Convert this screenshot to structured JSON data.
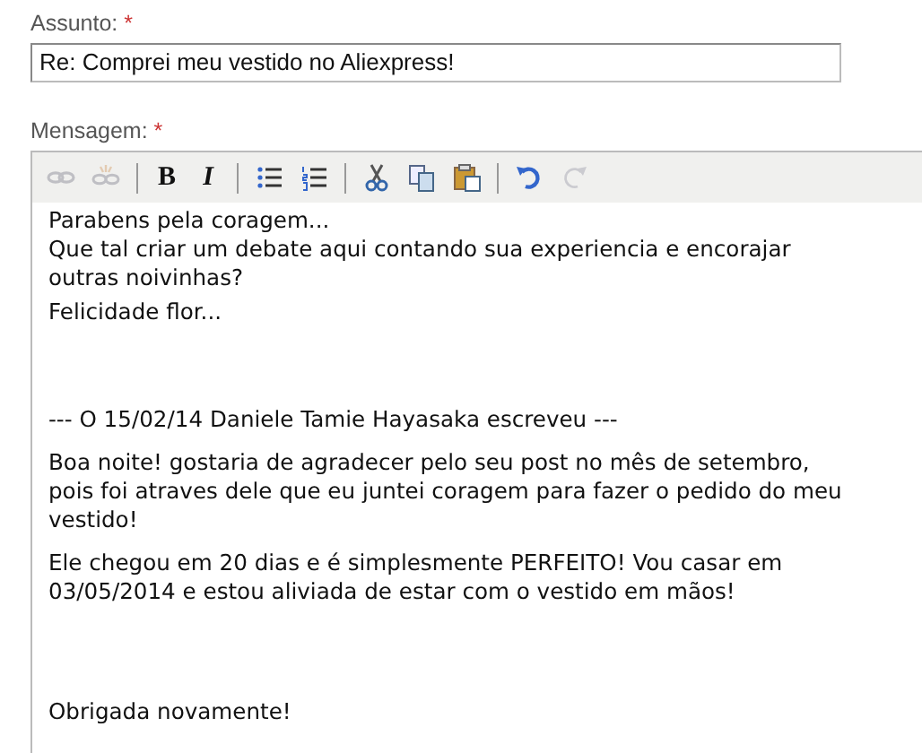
{
  "subject": {
    "label": "Assunto:",
    "required_mark": "*",
    "value": "Re: Comprei meu vestido no Aliexpress!"
  },
  "message": {
    "label": "Mensagem:",
    "required_mark": "*",
    "toolbar": [
      [
        {
          "kind": "link",
          "disabled": true
        },
        {
          "kind": "unlink",
          "disabled": true
        }
      ],
      [
        {
          "kind": "bold",
          "label": "B",
          "disabled": false
        },
        {
          "kind": "italic",
          "label": "I",
          "disabled": false
        }
      ],
      [
        {
          "kind": "bullets",
          "disabled": false
        },
        {
          "kind": "numbers",
          "disabled": false
        }
      ],
      [
        {
          "kind": "cut",
          "disabled": false
        },
        {
          "kind": "copy",
          "disabled": false
        },
        {
          "kind": "paste",
          "disabled": false
        }
      ],
      [
        {
          "kind": "undo",
          "disabled": false
        },
        {
          "kind": "redo",
          "disabled": true
        }
      ]
    ],
    "paragraphs": [
      [
        "Parabens pela coragem...",
        "Que tal criar um debate aqui contando sua experiencia e encorajar",
        "outras noivinhas?"
      ],
      [
        "Felicidade flor..."
      ],
      [
        "--- O 15/02/14 Daniele Tamie Hayasaka escreveu ---"
      ],
      [
        "Boa noite! gostaria de agradecer pelo seu post no mês de setembro,",
        "pois foi atraves dele que eu juntei coragem para fazer o pedido do meu",
        "vestido!"
      ],
      [
        "Ele chegou em 20 dias e é simplesmente PERFEITO! Vou casar em",
        "03/05/2014 e estou aliviada de estar com o vestido em mãos!"
      ],
      [
        "Obrigada novamente!"
      ]
    ]
  }
}
